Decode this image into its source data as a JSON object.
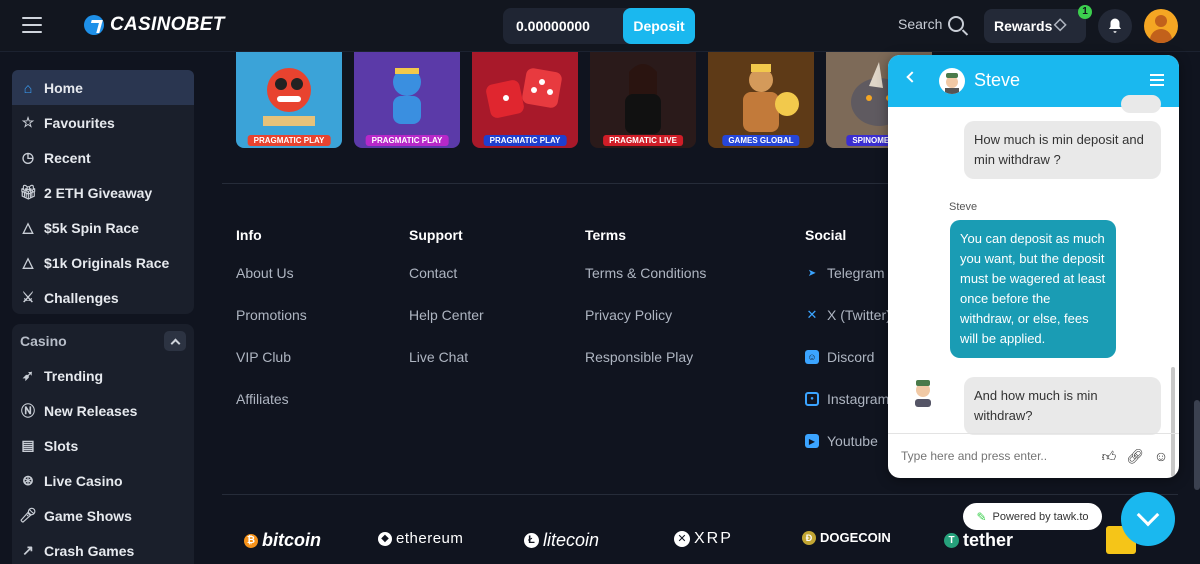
{
  "header": {
    "logo": "CASINOBET",
    "balance": "0.00000000",
    "coin_symbol": "₿",
    "deposit_label": "Deposit",
    "search_label": "Search",
    "rewards_label": "Rewards",
    "rewards_badge": "1"
  },
  "sidebar": {
    "items": [
      {
        "label": "Home",
        "icon": "home-icon"
      },
      {
        "label": "Favourites",
        "icon": "star-icon"
      },
      {
        "label": "Recent",
        "icon": "clock-icon"
      },
      {
        "label": "2 ETH Giveaway",
        "icon": "gift-icon"
      },
      {
        "label": "$5k Spin Race",
        "icon": "warning-icon"
      },
      {
        "label": "$1k Originals Race",
        "icon": "warning-icon"
      },
      {
        "label": "Challenges",
        "icon": "swords-icon"
      }
    ],
    "casino_header": "Casino",
    "casino_items": [
      {
        "label": "Trending",
        "icon": "rocket-icon"
      },
      {
        "label": "New Releases",
        "icon": "new-icon"
      },
      {
        "label": "Slots",
        "icon": "slot-machine-icon"
      },
      {
        "label": "Live Casino",
        "icon": "chip-icon"
      },
      {
        "label": "Game Shows",
        "icon": "microphone-icon"
      },
      {
        "label": "Crash Games",
        "icon": "chart-icon"
      }
    ]
  },
  "games": [
    {
      "provider": "PRAGMATIC PLAY",
      "bg": "#3ba3d8",
      "label_bg": "#e8432f"
    },
    {
      "provider": "PRAGMATIC PLAY",
      "bg": "#5b3aa8",
      "label_bg": "#b728c9"
    },
    {
      "provider": "PRAGMATIC PLAY",
      "bg": "#c2272d",
      "label_bg": "#1f3fcf"
    },
    {
      "provider": "PRAGMATIC LIVE",
      "bg": "#2a1a1a",
      "label_bg": "#d01d27"
    },
    {
      "provider": "GAMES GLOBAL",
      "bg": "#7a4a1f",
      "label_bg": "#2646d9"
    },
    {
      "provider": "SPINOMENAL",
      "bg": "#8a6a4a",
      "label_bg": "#3b2ed1"
    }
  ],
  "footer": {
    "info": {
      "title": "Info",
      "links": [
        "About Us",
        "Promotions",
        "VIP Club",
        "Affiliates"
      ]
    },
    "support": {
      "title": "Support",
      "links": [
        "Contact",
        "Help Center",
        "Live Chat"
      ]
    },
    "terms": {
      "title": "Terms",
      "links": [
        "Terms & Conditions",
        "Privacy Policy",
        "Responsible Play"
      ]
    },
    "social": {
      "title": "Social",
      "links": [
        {
          "label": "Telegram",
          "icon": "telegram-icon"
        },
        {
          "label": "X (Twitter)",
          "icon": "x-icon"
        },
        {
          "label": "Discord",
          "icon": "discord-icon"
        },
        {
          "label": "Instagram",
          "icon": "instagram-icon"
        },
        {
          "label": "Youtube",
          "icon": "youtube-icon"
        }
      ]
    }
  },
  "crypto": [
    "bitcoin",
    "ethereum",
    "litecoin",
    "XRP",
    "DOGECOIN",
    "tether"
  ],
  "chat": {
    "agent_name": "Steve",
    "messages": [
      {
        "from": "user",
        "text": "How much is min deposit and min withdraw ?"
      },
      {
        "from": "agent",
        "sender": "Steve",
        "text": "You can deposit as much you want, but the deposit must be wagered at least once before the withdraw, or else, fees will be applied."
      },
      {
        "from": "user",
        "text": "And how much is min withdraw?"
      }
    ],
    "input_placeholder": "Type here and press enter..",
    "powered_by": "Powered by tawk.to"
  }
}
